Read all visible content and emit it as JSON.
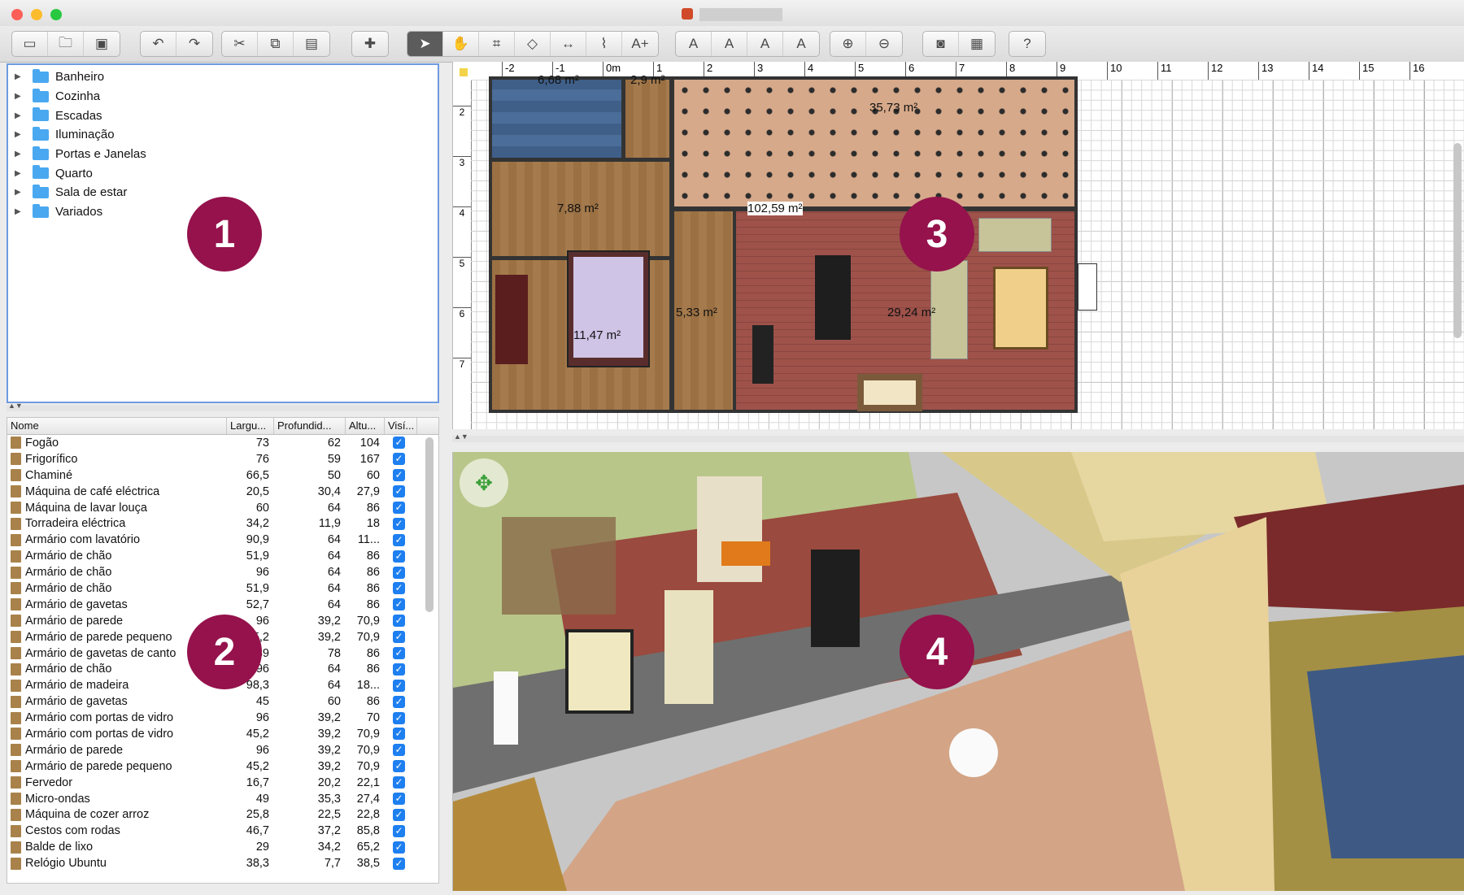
{
  "window": {
    "title": ""
  },
  "toolbar": {
    "groups": [
      [
        "new-icon",
        "open-icon",
        "save-icon"
      ],
      [
        "undo-icon",
        "redo-icon"
      ],
      [
        "cut-icon",
        "copy-icon",
        "paste-icon"
      ],
      [
        "add-furniture-icon"
      ],
      [
        "select-icon",
        "pan-icon",
        "create-walls-icon",
        "create-rooms-icon",
        "create-dimensions-icon",
        "create-polylines-icon",
        "add-text-icon"
      ],
      [
        "increase-text-icon",
        "decrease-text-icon",
        "bold-text-icon",
        "italic-text-icon"
      ],
      [
        "zoom-in-icon",
        "zoom-out-icon"
      ],
      [
        "create-photo-icon",
        "create-video-icon"
      ],
      [
        "help-icon"
      ]
    ]
  },
  "catalog": {
    "categories": [
      "Banheiro",
      "Cozinha",
      "Escadas",
      "Iluminação",
      "Portas e Janelas",
      "Quarto",
      "Sala de estar",
      "Variados"
    ]
  },
  "furniture": {
    "columns": [
      "Nome",
      "Largu...",
      "Profundid...",
      "Altu...",
      "Visí..."
    ],
    "rows": [
      {
        "name": "Fogão",
        "w": "73",
        "d": "62",
        "h": "104"
      },
      {
        "name": "Frigorífico",
        "w": "76",
        "d": "59",
        "h": "167"
      },
      {
        "name": "Chaminé",
        "w": "66,5",
        "d": "50",
        "h": "60"
      },
      {
        "name": "Máquina de café eléctrica",
        "w": "20,5",
        "d": "30,4",
        "h": "27,9"
      },
      {
        "name": "Máquina de lavar louça",
        "w": "60",
        "d": "64",
        "h": "86"
      },
      {
        "name": "Torradeira eléctrica",
        "w": "34,2",
        "d": "11,9",
        "h": "18"
      },
      {
        "name": "Armário com lavatório",
        "w": "90,9",
        "d": "64",
        "h": "11..."
      },
      {
        "name": "Armário de chão",
        "w": "51,9",
        "d": "64",
        "h": "86"
      },
      {
        "name": "Armário de chão",
        "w": "96",
        "d": "64",
        "h": "86"
      },
      {
        "name": "Armário de chão",
        "w": "51,9",
        "d": "64",
        "h": "86"
      },
      {
        "name": "Armário de gavetas",
        "w": "52,7",
        "d": "64",
        "h": "86"
      },
      {
        "name": "Armário de parede",
        "w": "96",
        "d": "39,2",
        "h": "70,9"
      },
      {
        "name": "Armário de parede pequeno",
        "w": "45,2",
        "d": "39,2",
        "h": "70,9"
      },
      {
        "name": "Armário de gavetas de canto",
        "w": "89",
        "d": "78",
        "h": "86"
      },
      {
        "name": "Armário de chão",
        "w": "96",
        "d": "64",
        "h": "86"
      },
      {
        "name": "Armário de madeira",
        "w": "98,3",
        "d": "64",
        "h": "18..."
      },
      {
        "name": "Armário de gavetas",
        "w": "45",
        "d": "60",
        "h": "86"
      },
      {
        "name": "Armário com portas de vidro",
        "w": "96",
        "d": "39,2",
        "h": "70"
      },
      {
        "name": "Armário com portas de vidro",
        "w": "45,2",
        "d": "39,2",
        "h": "70,9"
      },
      {
        "name": "Armário de parede",
        "w": "96",
        "d": "39,2",
        "h": "70,9"
      },
      {
        "name": "Armário de parede pequeno",
        "w": "45,2",
        "d": "39,2",
        "h": "70,9"
      },
      {
        "name": "Fervedor",
        "w": "16,7",
        "d": "20,2",
        "h": "22,1"
      },
      {
        "name": "Micro-ondas",
        "w": "49",
        "d": "35,3",
        "h": "27,4"
      },
      {
        "name": "Máquina de cozer arroz",
        "w": "25,8",
        "d": "22,5",
        "h": "22,8"
      },
      {
        "name": "Cestos com rodas",
        "w": "46,7",
        "d": "37,2",
        "h": "85,8"
      },
      {
        "name": "Balde de lixo",
        "w": "29",
        "d": "34,2",
        "h": "65,2"
      },
      {
        "name": "Relógio Ubuntu",
        "w": "38,3",
        "d": "7,7",
        "h": "38,5"
      }
    ]
  },
  "plan": {
    "ruler_x": [
      "-2",
      "-1",
      "0m",
      "1",
      "2",
      "3",
      "4",
      "5",
      "6",
      "7",
      "8",
      "9",
      "10",
      "11",
      "12",
      "13",
      "14",
      "15",
      "16"
    ],
    "ruler_y": [
      "2",
      "3",
      "4",
      "5",
      "6",
      "7"
    ],
    "areas": {
      "bath": "6,68 m²",
      "wc": "2,9 m²",
      "kitchen": "35,73 m²",
      "hall": "7,88 m²",
      "corridor": "102,59 m²",
      "bedroom": "11,47 m²",
      "passage": "5,33 m²",
      "living": "29,24 m²"
    }
  },
  "markers": [
    "1",
    "2",
    "3",
    "4"
  ],
  "colors": {
    "marker": "#95124c",
    "selection": "#6f9be0",
    "checkbox": "#1e7ff0"
  }
}
